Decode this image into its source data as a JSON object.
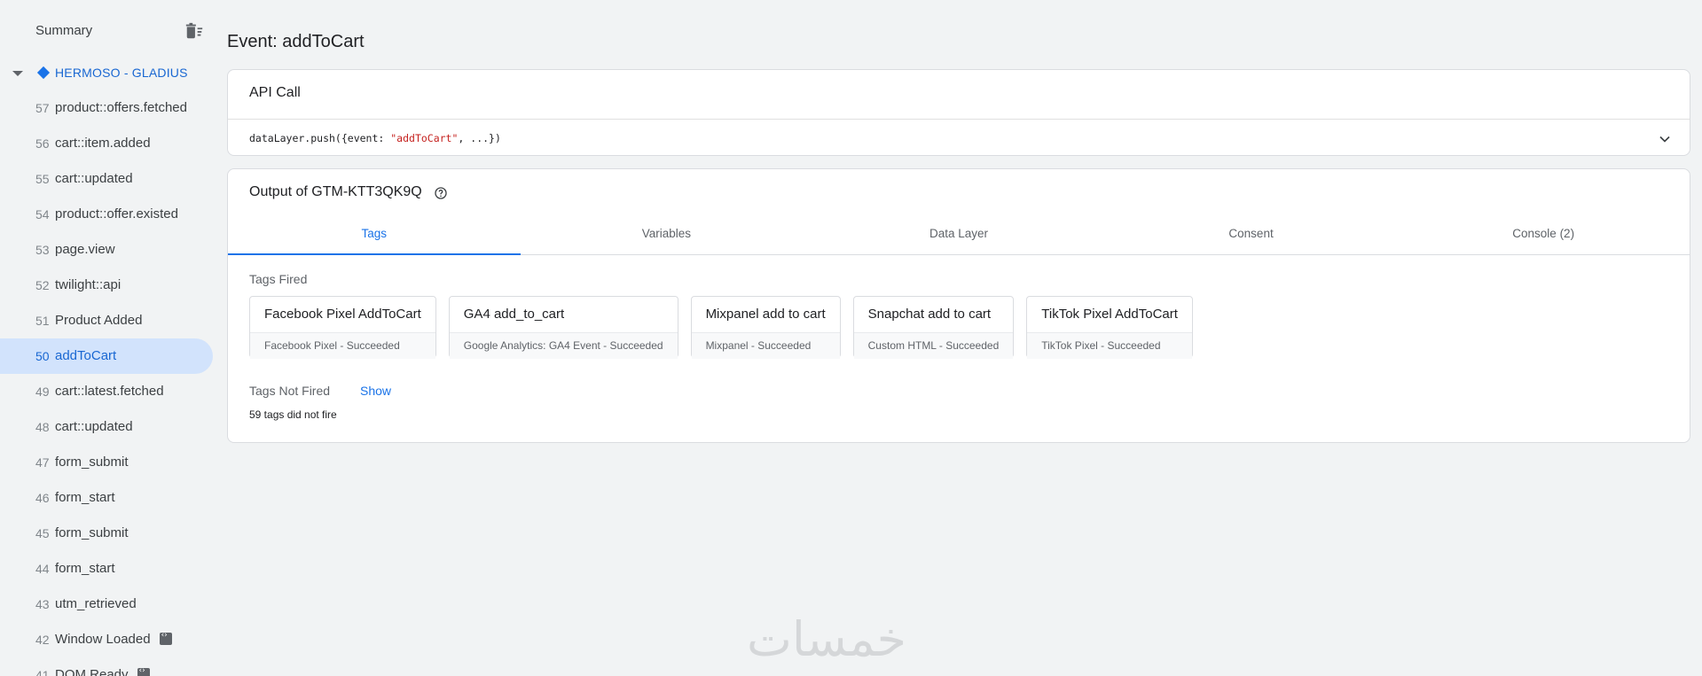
{
  "sidebar": {
    "summary_label": "Summary",
    "container_name": "HERMOSO - GLADIUS",
    "events": [
      {
        "num": "57",
        "label": "product::offers.fetched"
      },
      {
        "num": "56",
        "label": "cart::item.added"
      },
      {
        "num": "55",
        "label": "cart::updated"
      },
      {
        "num": "54",
        "label": "product::offer.existed"
      },
      {
        "num": "53",
        "label": "page.view"
      },
      {
        "num": "52",
        "label": "twilight::api"
      },
      {
        "num": "51",
        "label": "Product Added"
      },
      {
        "num": "50",
        "label": "addToCart",
        "selected": true
      },
      {
        "num": "49",
        "label": "cart::latest.fetched"
      },
      {
        "num": "48",
        "label": "cart::updated"
      },
      {
        "num": "47",
        "label": "form_submit"
      },
      {
        "num": "46",
        "label": "form_start"
      },
      {
        "num": "45",
        "label": "form_submit"
      },
      {
        "num": "44",
        "label": "form_start"
      },
      {
        "num": "43",
        "label": "utm_retrieved"
      },
      {
        "num": "42",
        "label": "Window Loaded",
        "badge": "code-icon"
      },
      {
        "num": "41",
        "label": "DOM Ready",
        "badge": "code-icon"
      }
    ]
  },
  "main": {
    "title": "Event: addToCart",
    "api_call": {
      "header": "API Call",
      "code_prefix": "dataLayer.push({event: ",
      "code_string": "\"addToCart\"",
      "code_suffix": ", ...})"
    },
    "output": {
      "title": "Output of GTM-KTT3QK9Q",
      "tabs": [
        {
          "label": "Tags",
          "active": true
        },
        {
          "label": "Variables"
        },
        {
          "label": "Data Layer"
        },
        {
          "label": "Consent"
        },
        {
          "label": "Console (2)"
        }
      ],
      "tags_fired_label": "Tags Fired",
      "tags_fired": [
        {
          "name": "Facebook Pixel AddToCart",
          "status": "Facebook Pixel - Succeeded"
        },
        {
          "name": "GA4 add_to_cart",
          "status": "Google Analytics: GA4 Event - Succeeded"
        },
        {
          "name": "Mixpanel add to cart",
          "status": "Mixpanel - Succeeded"
        },
        {
          "name": "Snapchat add to cart",
          "status": "Custom HTML - Succeeded"
        },
        {
          "name": "TikTok Pixel AddToCart",
          "status": "TikTok Pixel - Succeeded"
        }
      ],
      "tags_not_fired_label": "Tags Not Fired",
      "show_label": "Show",
      "not_fired_count": "59 tags did not fire"
    }
  },
  "watermark": "خمسات",
  "colors": {
    "accent": "#1a73e8",
    "selected_bg": "#d2e3fc",
    "code_string": "#c5221f"
  }
}
